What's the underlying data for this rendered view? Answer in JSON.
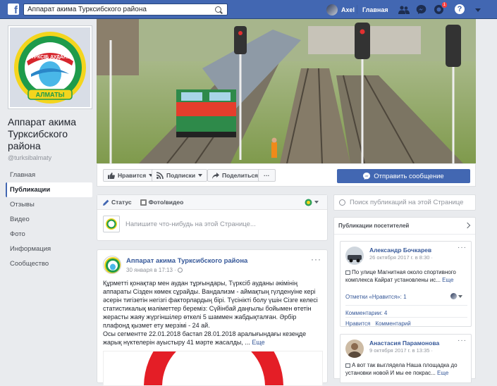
{
  "topbar": {
    "logo": "f",
    "search_value": "Аппарат акима Турксибского района",
    "user_name": "Axel",
    "home_label": "Главная",
    "notifications_count": "1",
    "help": "?"
  },
  "sidebar": {
    "page_name": "Аппарат акима Турксибского района",
    "handle": "@turksibalmaty",
    "logo_top_text": "ТҮРКСІБ АУДАНЫ",
    "logo_bottom_text": "АЛМАТЫ",
    "items": [
      {
        "label": "Главная"
      },
      {
        "label": "Публикации"
      },
      {
        "label": "Отзывы"
      },
      {
        "label": "Видео"
      },
      {
        "label": "Фото"
      },
      {
        "label": "Информация"
      },
      {
        "label": "Сообщество"
      }
    ]
  },
  "actions": {
    "like": "Нравится",
    "follow": "Подписки",
    "share": "Поделиться",
    "more": "···",
    "send_message": "Отправить сообщение"
  },
  "composer": {
    "tab_status": "Статус",
    "tab_photo": "Фото/видео",
    "placeholder": "Напишите что-нибудь на этой Странице..."
  },
  "post": {
    "author": "Аппарат акима Турксибского района",
    "date": "30 января в 17:13 ·",
    "text": "Құрметті қонақтар мен аудан тұрғындары, Түрксіб ауданы әкімінің аппараты Сізден көмек сұрайды. Вандализм - аймақтың гүлденуіне кері әсерін тигізетін негізгі факторлардың бірі. Түсінікті болу үшін Сізге келесі статистикалық мәліметтер береміз: Сүйінбай даңғылы бойымен өтетін жерасты жаяу жүргіншілер өткелі 5 шаммен жабдықталған. Әрбір плафонд қызмет ету мерзімі - 24 ай.",
    "text2_a": "Осы сегментте 22.01.2018 бастап 28.01.2018 аралығындағы кезеңде жарық нүктелерін ауыстыру ",
    "text2_num": "41",
    "text2_b": " мәрте жасалды, ... ",
    "see_more": "Еще"
  },
  "right": {
    "search_placeholder": "Поиск публикаций на этой Странице",
    "visitors_title": "Публикации посетителей",
    "posts": [
      {
        "name": "Александр Бочкарев",
        "date": "26 октября 2017 г. в 8:30 ·",
        "text": "По улице Магнитная около спортивного комплекса Кайрат установлены ис... ",
        "see_more": "Еще",
        "likes": "Отметки «Нравится»: 1",
        "comments": "Комментарии: 4",
        "like_btn": "Нравится",
        "comment_btn": "Комментарий"
      },
      {
        "name": "Анастасия Парамонова",
        "date": "9 октября 2017 г. в 13:35 ·",
        "text": "А вот так выглядела Наша площадка до установки новой И мы ее покрас... ",
        "see_more": "Еще"
      }
    ]
  },
  "colors": {
    "fb_blue": "#4267b2",
    "link": "#365899",
    "bg": "#e9ebee"
  }
}
